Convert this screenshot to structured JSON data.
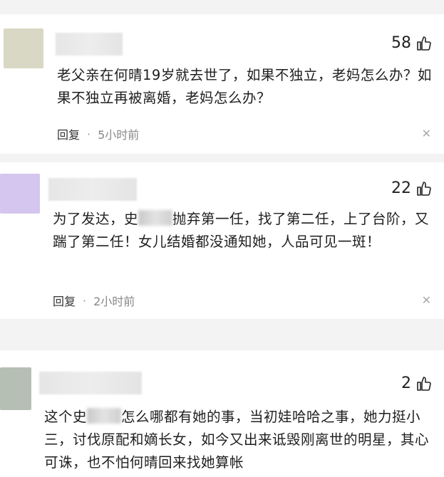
{
  "comments": [
    {
      "likes": "58",
      "avatar_color": "#d8d8c4",
      "text_parts": [
        "老父亲在何晴19岁就去世了，如果不独立，老妈怎么办？如果不独立再被离婚，老妈怎么办？"
      ],
      "reply_label": "回复",
      "separator": "·",
      "time": "5小时前",
      "close_icon": "close-icon"
    },
    {
      "likes": "22",
      "avatar_color": "#d4c6ee",
      "text_parts": [
        "为了发达，史",
        "抛弃第一任，找了第二任，上了台阶，又踹了第二任！女儿结婚都没通知她，人品可见一斑！"
      ],
      "reply_label": "回复",
      "separator": "·",
      "time": "2小时前",
      "close_icon": "close-icon"
    },
    {
      "likes": "2",
      "avatar_color": "#b6bfb3",
      "text_parts": [
        "这个史",
        "怎么哪都有她的事，当初娃哈哈之事，她力挺小三，讨伐原配和嫡长女，如今又出来诋毁刚离世的明星，其心可诛，也不怕何晴回来找她算帐"
      ]
    }
  ],
  "icons": {
    "like": "thumbs-up-icon",
    "close": "close-icon"
  }
}
